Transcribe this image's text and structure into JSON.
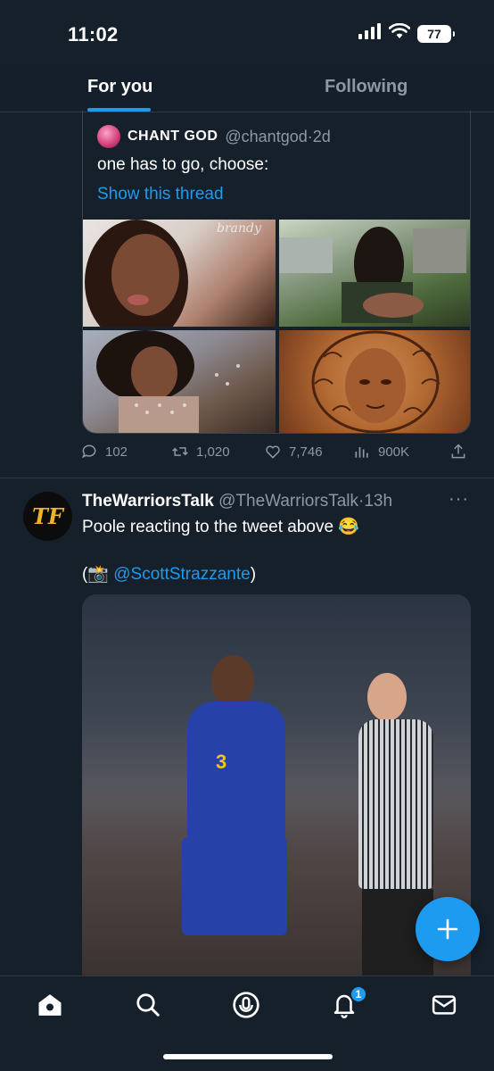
{
  "status_bar": {
    "time": "11:02",
    "battery": "77"
  },
  "tabs": [
    {
      "label": "For you"
    },
    {
      "label": "Following"
    }
  ],
  "quote_tweet": {
    "name": "CHANT GOD",
    "handle": "@chantgod",
    "separator": "·",
    "time": "2d",
    "text": "one has to go, choose:",
    "link": "Show this thread",
    "image_caption": "brandy"
  },
  "quote_actions": {
    "replies": "102",
    "retweets": "1,020",
    "likes": "7,746",
    "views": "900K"
  },
  "tweet2": {
    "name": "TheWarriorsTalk",
    "handle": "@TheWarriorsTalk",
    "separator": "·",
    "time": "13h",
    "more": "···",
    "text": "Poole reacting to the tweet above 😂",
    "credit_open": "(📸 ",
    "credit_mention": "@ScottStrazzante",
    "credit_close": ")",
    "jersey_number": "3",
    "avatar_letters": "TF"
  },
  "nav": {
    "notifications_badge": "1",
    "items": [
      "home-icon",
      "search-icon",
      "spaces-icon",
      "notifications-icon",
      "messages-icon"
    ]
  },
  "colors": {
    "background": "#15202b",
    "accent": "#1d9bf0",
    "secondary_text": "#8b98a5",
    "border": "#2f3b47"
  }
}
